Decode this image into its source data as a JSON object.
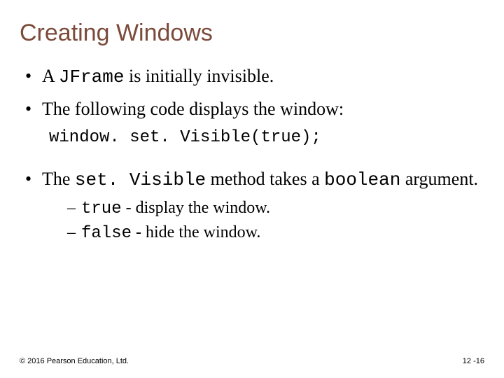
{
  "title": "Creating Windows",
  "bullets": {
    "b1_pre": "A ",
    "b1_code": "JFrame",
    "b1_post": " is initially invisible.",
    "b2": "The following code displays the window:",
    "code_line": "window. set. Visible(true);",
    "b3_pre": "The ",
    "b3_code1": "set. Visible",
    "b3_mid": " method takes a ",
    "b3_code2": "boolean",
    "b3_post": " argument.",
    "sub1_code": "true",
    "sub1_post": " - display the window.",
    "sub2_code": "false",
    "sub2_post": " - hide the window."
  },
  "footer": {
    "left": "© 2016 Pearson Education, Ltd.",
    "right": "12 -16"
  }
}
